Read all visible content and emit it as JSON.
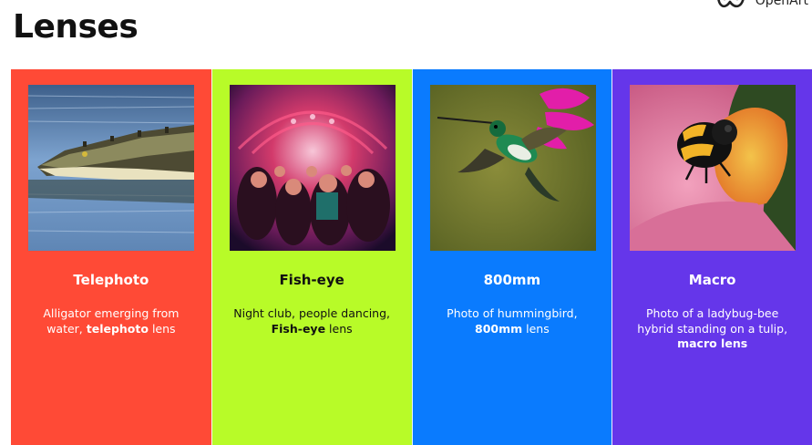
{
  "page": {
    "title": "Lenses",
    "brand": "OpenArt"
  },
  "cards": [
    {
      "title": "Telephoto",
      "desc_before": "Alligator emerging from water, ",
      "desc_bold": "telephoto",
      "desc_after": " lens",
      "color": "#ff4a36",
      "image": "alligator-photo"
    },
    {
      "title": "Fish-eye",
      "desc_before": "Night club, people dancing, ",
      "desc_bold": "Fish-eye",
      "desc_after": " lens",
      "color": "#b8fb28",
      "image": "night-club-photo"
    },
    {
      "title": "800mm",
      "desc_before": "Photo of hummingbird, ",
      "desc_bold": "800mm",
      "desc_after": " lens",
      "color": "#0a7bfe",
      "image": "hummingbird-photo"
    },
    {
      "title": "Macro",
      "desc_before": "Photo of a ladybug-bee hybrid standing on a tulip, ",
      "desc_bold": "macro lens",
      "desc_after": "",
      "color": "#6536ea",
      "image": "ladybug-bee-photo"
    }
  ]
}
